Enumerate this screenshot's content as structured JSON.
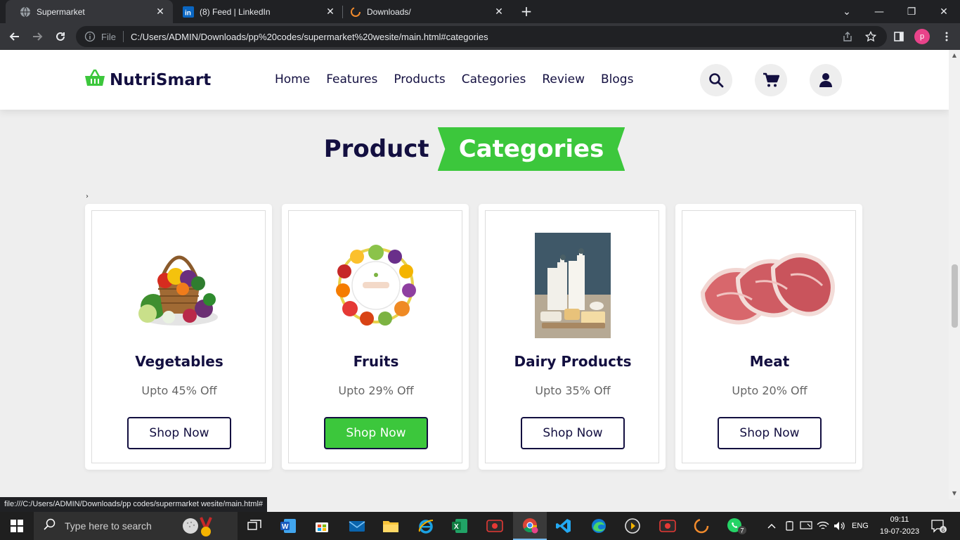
{
  "browser": {
    "tabs": [
      {
        "title": "Supermarket",
        "active": true
      },
      {
        "title": "(8) Feed | LinkedIn",
        "active": false
      },
      {
        "title": "Downloads/",
        "active": false
      }
    ],
    "omnibox": {
      "scheme_label": "File",
      "url": "C:/Users/ADMIN/Downloads/pp%20codes/supermarket%20wesite/main.html#categories"
    },
    "profile_initial": "p",
    "status_url": "file:///C:/Users/ADMIN/Downloads/pp codes/supermarket wesite/main.html#"
  },
  "site": {
    "logo_text": "NutriSmart",
    "nav": [
      "Home",
      "Features",
      "Products",
      "Categories",
      "Review",
      "Blogs"
    ],
    "heading_plain": "Product",
    "heading_highlight": "Categories",
    "marker": "›",
    "cards": [
      {
        "name": "Vegetables",
        "discount": "Upto 45% Off",
        "button": "Shop Now",
        "image": "vegetable-basket-icon"
      },
      {
        "name": "Fruits",
        "discount": "Upto 29% Off",
        "button": "Shop Now",
        "image": "fruit-wreath-icon"
      },
      {
        "name": "Dairy Products",
        "discount": "Upto 35% Off",
        "button": "Shop Now",
        "image": "dairy-icon"
      },
      {
        "name": "Meat",
        "discount": "Upto 20% Off",
        "button": "Shop Now",
        "image": "meat-icon"
      }
    ],
    "accent_color": "#3cc73c",
    "dark_color": "#130f40"
  },
  "taskbar": {
    "search_placeholder": "Type here to search",
    "language": "ENG",
    "time": "09:11",
    "date": "19-07-2023",
    "whatsapp_badge": "7",
    "notification_badge": "6"
  }
}
